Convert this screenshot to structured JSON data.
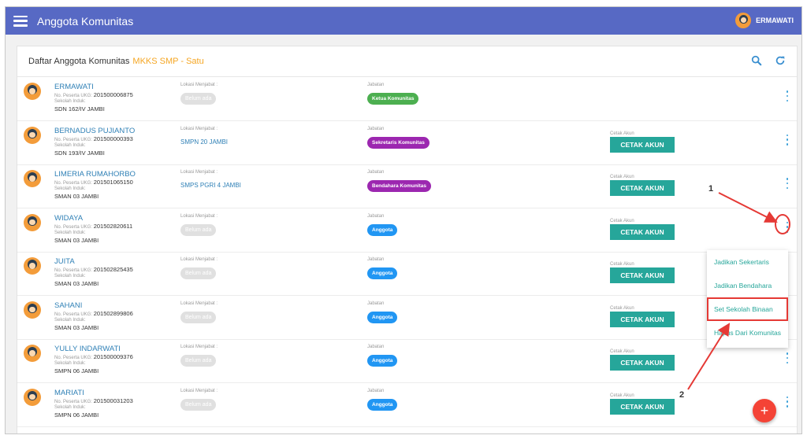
{
  "header": {
    "title": "Anggota Komunitas",
    "user_name": "ERMAWATI"
  },
  "card": {
    "title": "Daftar Anggota Komunitas",
    "community": "MKKS SMP - Satu"
  },
  "labels": {
    "no_peserta": "No. Peserta UKG:",
    "sekolah_induk": "Sekolah Induk:",
    "lokasi": "Lokasi Menjabat :",
    "jabatan": "Jabatan",
    "cetak_label": "Cetak Akun",
    "cetak_button": "CETAK AKUN",
    "belum_ada": "Belum ada"
  },
  "members": [
    {
      "name": "ERMAWATI",
      "no_peserta": "201500006875",
      "school": "SDN 162/IV JAMBI",
      "lokasi": "",
      "jabatan": "Ketua Komunitas",
      "jabatan_color": "#4caf50",
      "cetak": false
    },
    {
      "name": "BERNADUS PUJIANTO",
      "no_peserta": "201500000393",
      "school": "SDN 193/IV JAMBI",
      "lokasi": "SMPN 20 JAMBI",
      "jabatan": "Sekretaris Komunitas",
      "jabatan_color": "#9c27b0",
      "cetak": true
    },
    {
      "name": "LIMERIA RUMAHORBO",
      "no_peserta": "201501065150",
      "school": "SMAN 03 JAMBI",
      "lokasi": "SMPS PGRI 4 JAMBI",
      "jabatan": "Bendahara Komunitas",
      "jabatan_color": "#9c27b0",
      "cetak": true
    },
    {
      "name": "WIDAYA",
      "no_peserta": "201502820611",
      "school": "SMAN 03 JAMBI",
      "lokasi": "",
      "jabatan": "Anggota",
      "jabatan_color": "#2196f3",
      "cetak": true
    },
    {
      "name": "JUITA",
      "no_peserta": "201502825435",
      "school": "SMAN 03 JAMBI",
      "lokasi": "",
      "jabatan": "Anggota",
      "jabatan_color": "#2196f3",
      "cetak": true
    },
    {
      "name": "SAHANI",
      "no_peserta": "201502899806",
      "school": "SMAN 03 JAMBI",
      "lokasi": "",
      "jabatan": "Anggota",
      "jabatan_color": "#2196f3",
      "cetak": true
    },
    {
      "name": "YULLY INDARWATI",
      "no_peserta": "201500009376",
      "school": "SMPN 06 JAMBI",
      "lokasi": "",
      "jabatan": "Anggota",
      "jabatan_color": "#2196f3",
      "cetak": true
    },
    {
      "name": "MARIATI",
      "no_peserta": "201500031203",
      "school": "SMPN 06 JAMBI",
      "lokasi": "",
      "jabatan": "Anggota",
      "jabatan_color": "#2196f3",
      "cetak": true
    }
  ],
  "dropdown": {
    "items": [
      "Jadikan Sekertaris",
      "Jadikan Bendahara",
      "Set Sekolah Binaan",
      "Hapus Dari Komunitas"
    ]
  },
  "fab_label": "+",
  "annotations": {
    "one": "1",
    "two": "2",
    "color": "#e53935"
  }
}
